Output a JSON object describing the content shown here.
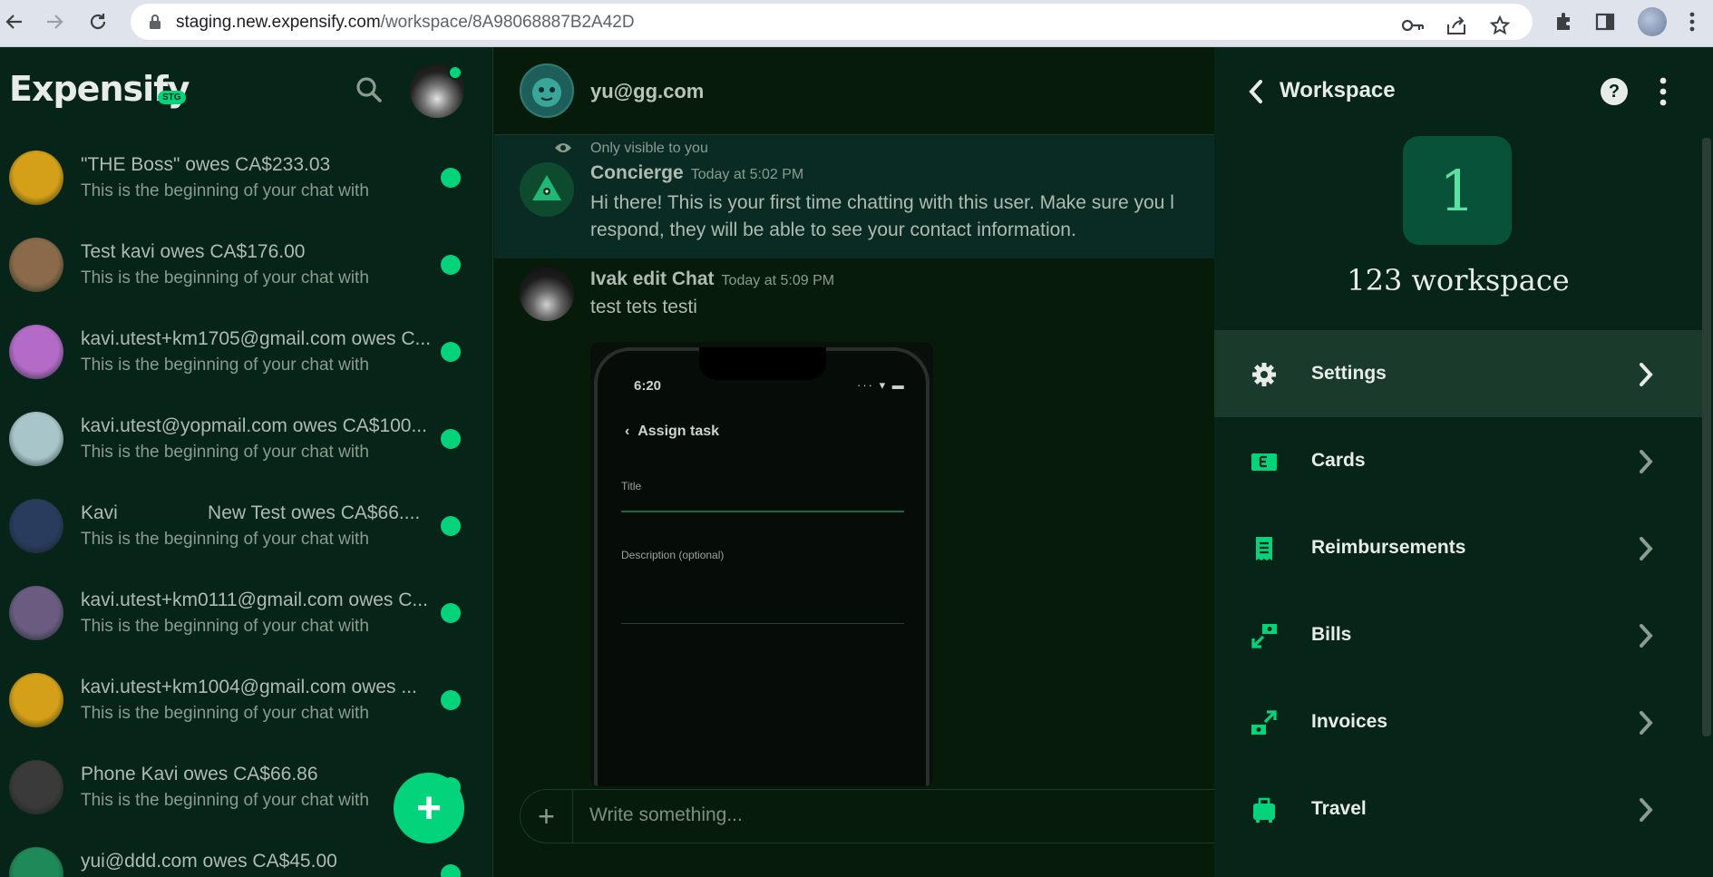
{
  "browser": {
    "url_host": "staging.new.expensify.com",
    "url_path": "/workspace/8A98068887B2A42D"
  },
  "lhn": {
    "logo": "Expensify",
    "env_badge": "STG",
    "chats": [
      {
        "title": "\"THE Boss\" owes CA$233.03",
        "subtitle": "This is the beginning of your chat with",
        "avatar_color": "#d4a017"
      },
      {
        "title": "Test kavi owes CA$176.00",
        "subtitle": "This is the beginning of your chat with",
        "avatar_color": "#8a6a4a"
      },
      {
        "title": "kavi.utest+km1705@gmail.com owes C...",
        "subtitle": "This is the beginning of your chat with",
        "avatar_color": "#b36bc7"
      },
      {
        "title": "kavi.utest@yopmail.com owes CA$100...",
        "subtitle": "This is the beginning of your chat with",
        "avatar_color": "#a8c6c9"
      },
      {
        "title": "Kavi                 New Test owes CA$66....",
        "subtitle": "This is the beginning of your chat with",
        "avatar_color": "#2a3c5e"
      },
      {
        "title": "kavi.utest+km0111@gmail.com owes C...",
        "subtitle": "This is the beginning of your chat with",
        "avatar_color": "#6a5c80"
      },
      {
        "title": "kavi.utest+km1004@gmail.com owes ...",
        "subtitle": "This is the beginning of your chat with",
        "avatar_color": "#d4a017"
      },
      {
        "title": "Phone Kavi owes CA$66.86",
        "subtitle": "This is the beginning of your chat with",
        "avatar_color": "#3a3a3a"
      },
      {
        "title": "yui@ddd.com owes CA$45.00",
        "subtitle": "",
        "avatar_color": "#1e8a5a"
      }
    ]
  },
  "report": {
    "header_title": "yu@gg.com",
    "only_visible": "Only visible to you",
    "messages": [
      {
        "author": "Concierge",
        "time": "Today at 5:02 PM",
        "lines": [
          "Hi there! This is your first time chatting with this user. Make sure you l",
          "respond, they will be able to see your contact information."
        ]
      },
      {
        "author": "Ivak edit Chat",
        "time": "Today at 5:09 PM",
        "lines": [
          "test tets testi"
        ]
      }
    ],
    "attachment": {
      "time": "6:20",
      "back_label": "Assign task",
      "title_label": "Title",
      "description_label": "Description (optional)"
    },
    "composer_placeholder": "Write something..."
  },
  "workspace": {
    "header_title": "Workspace",
    "avatar_letter": "1",
    "name": "123 workspace",
    "items": [
      {
        "label": "Settings",
        "icon": "gear-icon"
      },
      {
        "label": "Cards",
        "icon": "card-icon"
      },
      {
        "label": "Reimbursements",
        "icon": "receipt-icon"
      },
      {
        "label": "Bills",
        "icon": "bill-icon"
      },
      {
        "label": "Invoices",
        "icon": "invoice-icon"
      },
      {
        "label": "Travel",
        "icon": "luggage-icon"
      }
    ]
  },
  "colors": {
    "accent": "#03d47c",
    "background": "#061b09",
    "panel": "#072419"
  }
}
